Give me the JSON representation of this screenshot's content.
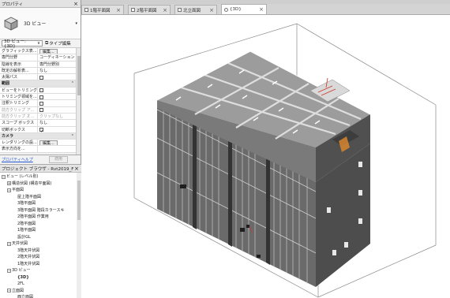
{
  "properties": {
    "title": "プロパティ",
    "type_name": "3D ビュー",
    "selector_value": "3D ビュー: {3D}",
    "edit_type_label": "タイプ編集",
    "rows": [
      {
        "key": "グラフィックス表...",
        "val": "編集..."
      },
      {
        "key": "専門分野",
        "val": "コーディネーション"
      },
      {
        "key": "陰線を表示",
        "val": "専門分野別"
      },
      {
        "key": "既定の解析表...",
        "val": "なし"
      },
      {
        "key": "太陽パス",
        "val": ""
      },
      {
        "key": "範囲",
        "val": "",
        "group": true
      },
      {
        "key": "ビューをトリミング",
        "val": ""
      },
      {
        "key": "トリミング領域を...",
        "val": ""
      },
      {
        "key": "注釈トリミング",
        "val": ""
      },
      {
        "key": "前方クリップ ア...",
        "val": ""
      },
      {
        "key": "前方クリップ オ...",
        "val": "クリップなし"
      },
      {
        "key": "スコープ ボックス",
        "val": "なし"
      },
      {
        "key": "切断ボックス",
        "val": ""
      },
      {
        "key": "カメラ",
        "val": "",
        "group": true
      },
      {
        "key": "レンダリングの設...",
        "val": "編集..."
      },
      {
        "key": "表示方向を...",
        "val": ""
      }
    ],
    "help_link": "プロパティヘルプ",
    "apply_label": "適用"
  },
  "browser": {
    "title": "プロジェクト ブラウザ - Rvt2019_Fun_Tr...",
    "items": [
      {
        "label": "ビュー (レベル別)",
        "indent": 0,
        "toggle": "−"
      },
      {
        "label": "構造伏図 (構造平面図)",
        "indent": 1,
        "toggle": "+"
      },
      {
        "label": "平面図",
        "indent": 1,
        "toggle": "−"
      },
      {
        "label": "屋上階平面図",
        "indent": 2,
        "toggle": ""
      },
      {
        "label": "3階平面図",
        "indent": 2,
        "toggle": ""
      },
      {
        "label": "3階平面図 階段カラースキ",
        "indent": 2,
        "toggle": ""
      },
      {
        "label": "2階平面図 作業用",
        "indent": 2,
        "toggle": ""
      },
      {
        "label": "2階平面図",
        "indent": 2,
        "toggle": ""
      },
      {
        "label": "1階平面図",
        "indent": 2,
        "toggle": ""
      },
      {
        "label": "設計GL",
        "indent": 2,
        "toggle": ""
      },
      {
        "label": "天井伏図",
        "indent": 1,
        "toggle": "−"
      },
      {
        "label": "3階天井伏図",
        "indent": 2,
        "toggle": ""
      },
      {
        "label": "2階天井伏図",
        "indent": 2,
        "toggle": ""
      },
      {
        "label": "1階天井伏図",
        "indent": 2,
        "toggle": ""
      },
      {
        "label": "3D ビュー",
        "indent": 1,
        "toggle": "−"
      },
      {
        "label": "{3D}",
        "indent": 2,
        "toggle": "",
        "bold": true
      },
      {
        "label": "2FL",
        "indent": 2,
        "toggle": ""
      },
      {
        "label": "立面図",
        "indent": 1,
        "toggle": "−"
      },
      {
        "label": "西立面図",
        "indent": 2,
        "toggle": ""
      }
    ]
  },
  "tabs": [
    {
      "label": "1階平面図",
      "active": false
    },
    {
      "label": "2階平面図",
      "active": false
    },
    {
      "label": "北立面図",
      "active": false
    },
    {
      "label": "{3D}",
      "active": true
    }
  ],
  "colors": {
    "slab": "#9c9c9c",
    "wall": "#5a5a5a",
    "dark_wall": "#3c3c3c",
    "beam": "#d2d2d2",
    "accent_red": "#c83a2a",
    "accent_orange": "#e08a2c",
    "link_blue": "#2255cc"
  }
}
